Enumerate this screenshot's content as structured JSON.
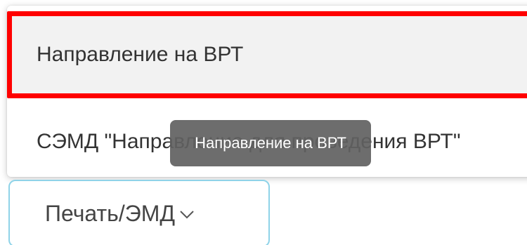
{
  "menu": {
    "items": [
      {
        "label": "Направление на ВРТ"
      },
      {
        "label": "СЭМД \"Направление для проведения ВРТ\""
      }
    ]
  },
  "tooltip": {
    "text": "Направление на ВРТ"
  },
  "print_button": {
    "label": "Печать/ЭМД",
    "icon": "chevron-down-icon"
  },
  "colors": {
    "highlight_border": "#ff0000",
    "button_border": "#8fd3e8",
    "tooltip_bg": "#616161"
  }
}
